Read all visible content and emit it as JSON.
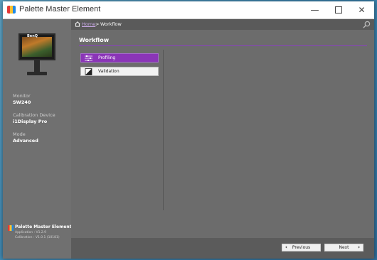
{
  "window": {
    "title": "Palette Master Element",
    "minimize_icon": "minimize-icon",
    "maximize_icon": "maximize-icon",
    "close_icon": "close-icon"
  },
  "sidebar": {
    "monitor_brand": "BenQ",
    "monitor_label": "Monitor",
    "monitor_value": "SW240",
    "device_label": "Calibration Device",
    "device_value": "i1Display Pro",
    "mode_label": "Mode",
    "mode_value": "Advanced",
    "footer_title": "Palette Master Element",
    "footer_line1": "Application : V1.2.9",
    "footer_line2": "Calibration : V1.0.1 (10181)"
  },
  "breadcrumb": {
    "home": "Home",
    "separator": ">",
    "current": "Workflow"
  },
  "main": {
    "section_title": "Workflow",
    "items": [
      {
        "label": "Profiling",
        "icon": "sliders-icon",
        "active": true
      },
      {
        "label": "Validation",
        "icon": "contrast-square-icon",
        "active": false
      }
    ]
  },
  "footer_nav": {
    "previous_label": "Previous",
    "next_label": "Next"
  },
  "colors": {
    "accent": "#8b35b8",
    "link": "#c9a9e6"
  }
}
